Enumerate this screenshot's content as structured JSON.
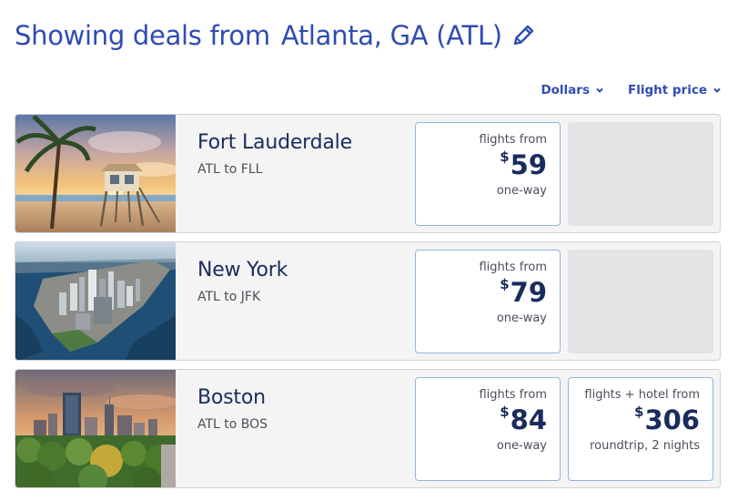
{
  "header": {
    "title_prefix": "Showing deals from",
    "origin": "Atlanta, GA (ATL)"
  },
  "controls": {
    "currency": "Dollars",
    "sort": "Flight price"
  },
  "colors": {
    "brand_blue": "#304cb2",
    "dark_navy": "#1a2b5e",
    "box_border": "#8eb6e0",
    "card_bg": "#f4f4f4"
  },
  "deals": [
    {
      "city": "Fort Lauderdale",
      "route": "ATL to FLL",
      "image": "beach-lifeguard-tower-photo",
      "flight": {
        "label": "flights from",
        "currency": "$",
        "price": "59",
        "note": "one-way"
      }
    },
    {
      "city": "New York",
      "route": "ATL to JFK",
      "image": "manhattan-aerial-photo",
      "flight": {
        "label": "flights from",
        "currency": "$",
        "price": "79",
        "note": "one-way"
      }
    },
    {
      "city": "Boston",
      "route": "ATL to BOS",
      "image": "boston-skyline-sunset-photo",
      "flight": {
        "label": "flights from",
        "currency": "$",
        "price": "84",
        "note": "one-way"
      },
      "bundle": {
        "label": "flights + hotel from",
        "currency": "$",
        "price": "306",
        "note": "roundtrip, 2 nights"
      }
    }
  ]
}
